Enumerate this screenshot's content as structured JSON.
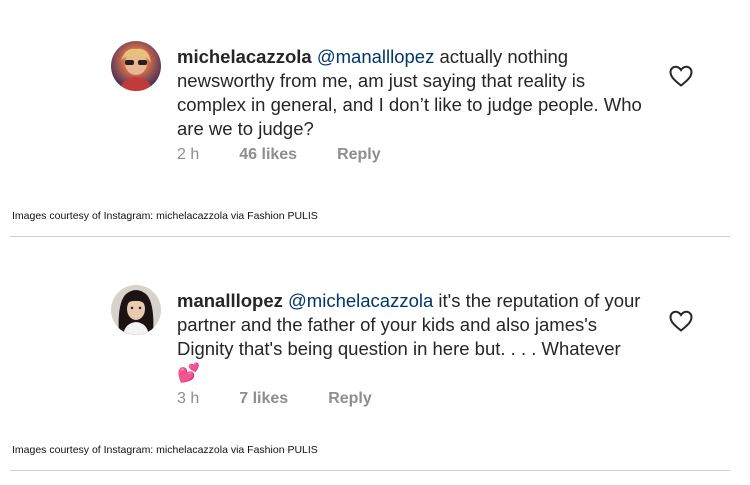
{
  "comments": [
    {
      "username": "michelacazzola",
      "mention": "@manalllopez",
      "text": " actually nothing newsworthy from me, am just saying that reality is complex in general, and I don’t like to judge people. Who are we to judge?",
      "time": "2 h",
      "likes": "46 likes",
      "reply_label": "Reply",
      "caption": "Images courtesy of Instagram: michelacazzola via Fashion PULIS"
    },
    {
      "username": "manalllopez",
      "mention": "@michelacazzola",
      "text": " it's the reputation of your partner and the father of your kids and also james's Dignity that's being question in here but. . . . Whatever ",
      "emoji": "💕",
      "time": "3 h",
      "likes": "7 likes",
      "reply_label": "Reply",
      "caption": "Images courtesy of Instagram: michelacazzola via Fashion PULIS"
    }
  ],
  "colors": {
    "text": "#262626",
    "secondary": "#8e8e8e",
    "mention": "#00376b",
    "divider": "#cfcfcf"
  },
  "icons": {
    "like": "heart-outline-icon"
  }
}
